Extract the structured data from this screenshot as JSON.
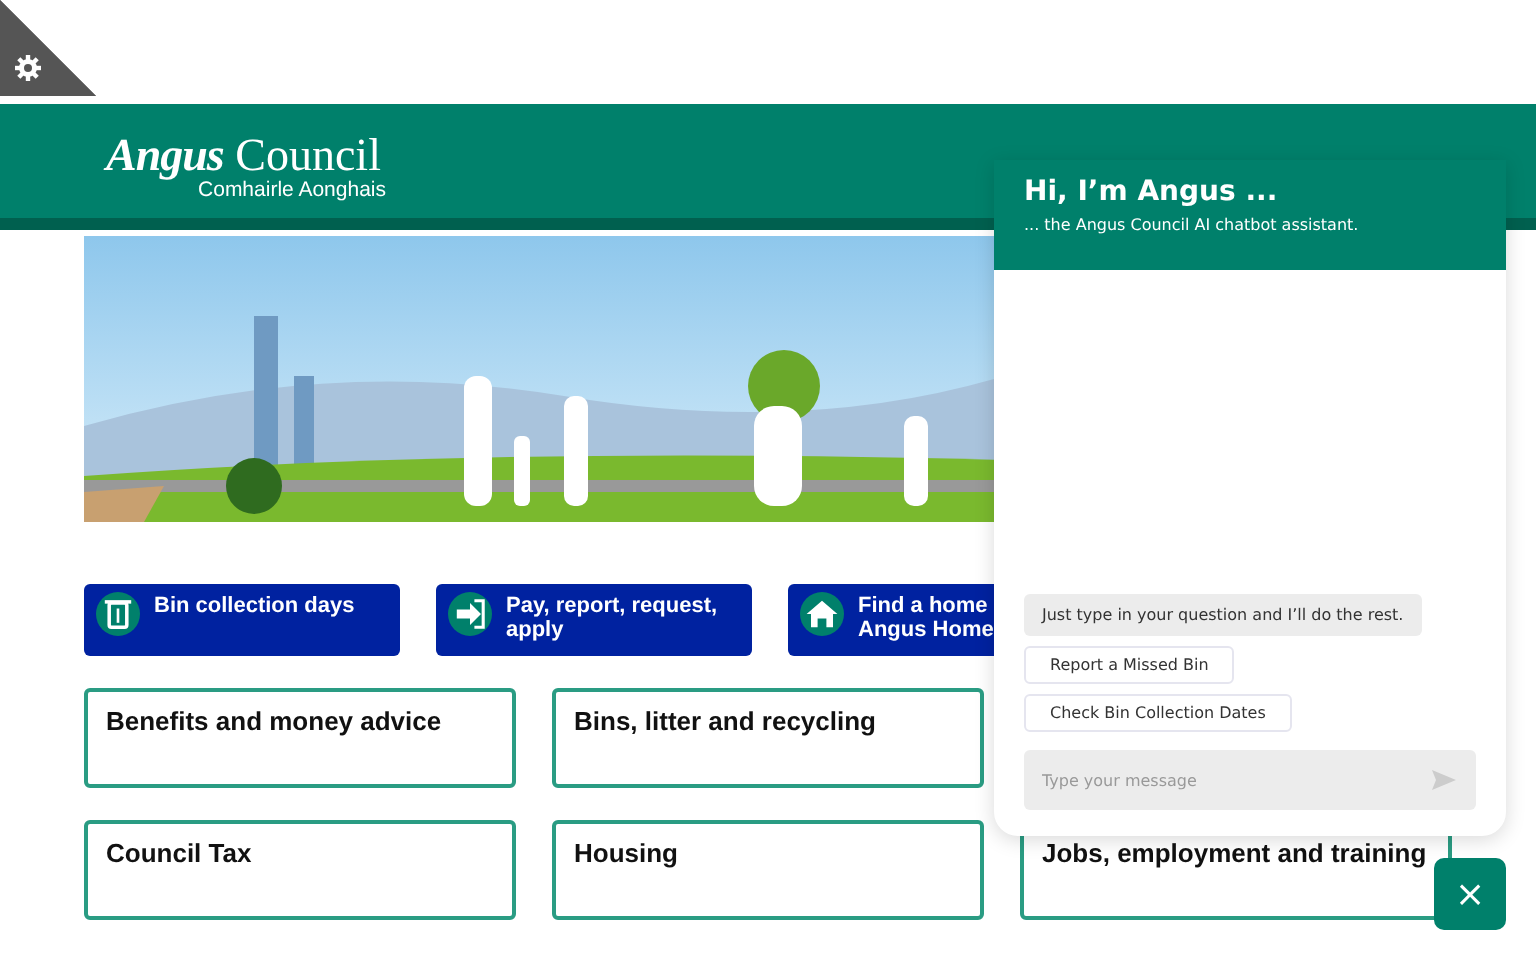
{
  "header": {
    "logo_main_1": "Angus",
    "logo_main_2": "Council",
    "logo_sub": "Comhairle Aonghais"
  },
  "quick_links": [
    {
      "lines": [
        "Bin collection days"
      ]
    },
    {
      "lines": [
        "Pay, report, request,",
        "apply"
      ]
    },
    {
      "lines": [
        "Find a home",
        "Angus Home"
      ]
    }
  ],
  "tiles": [
    [
      "Benefits and money advice",
      "Bins, litter and recycling"
    ],
    [
      "Council Tax",
      "Housing",
      "Jobs, employment and training"
    ]
  ],
  "chat": {
    "title": "Hi, I’m Angus ...",
    "subtitle": "... the Angus Council AI chatbot assistant.",
    "messages": [
      {
        "kind": "bubble",
        "text": "Just type in your question and I’ll do the rest."
      },
      {
        "kind": "option",
        "text": "Report a Missed Bin"
      },
      {
        "kind": "option",
        "text": "Check Bin Collection Dates"
      }
    ],
    "input": {
      "placeholder": "Type your message"
    },
    "close_label": "×"
  }
}
